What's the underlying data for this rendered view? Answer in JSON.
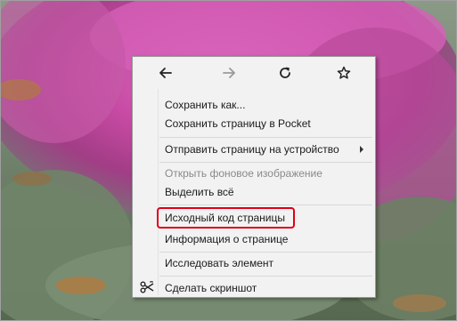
{
  "colors": {
    "menu_bg": "#f2f2f2",
    "highlight_border": "#e00016",
    "disabled_text": "#8a8a8a",
    "background_dominant": "#c44b9c"
  },
  "nav": {
    "back_icon": "arrow-left-icon",
    "forward_icon": "arrow-right-icon",
    "reload_icon": "reload-icon",
    "bookmark_icon": "star-icon"
  },
  "menu": {
    "save_as": "Сохранить как...",
    "save_to_pocket": "Сохранить страницу в Pocket",
    "send_to_device": "Отправить страницу на устройство",
    "view_background": "Открыть фоновое изображение",
    "select_all": "Выделить всё",
    "view_source": "Исходный код страницы",
    "page_info": "Информация о странице",
    "inspect": "Исследовать элемент",
    "screenshot": "Сделать скриншот"
  }
}
